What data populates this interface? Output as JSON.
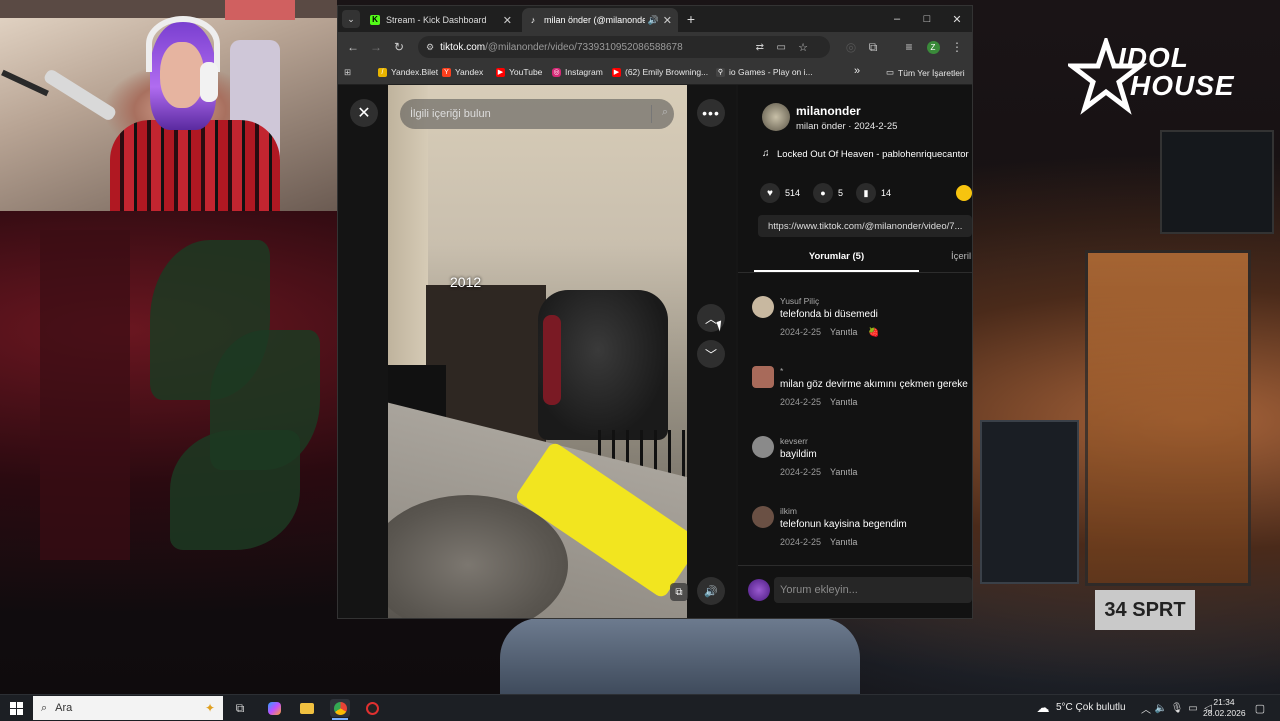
{
  "overlay": {
    "logo_line1": "IDOL",
    "logo_line2": "HOUSE"
  },
  "browser": {
    "tabs": [
      {
        "label": "Stream - Kick Dashboard",
        "active": false
      },
      {
        "label": "milan önder (@milanonder)",
        "active": true
      }
    ],
    "new_tab": "+",
    "window_controls": {
      "minimize": "–",
      "maximize": "□",
      "close": "✕"
    },
    "url_host": "tiktok.com",
    "url_path": "/@milanonder/video/7339310952086588678",
    "profile_initial": "Z",
    "bookmarks": [
      {
        "label": "Yandex.Bilet",
        "icon_color": "#e8b400"
      },
      {
        "label": "Yandex",
        "icon_color": "#fc3f1d"
      },
      {
        "label": "YouTube",
        "icon_color": "#ff0000"
      },
      {
        "label": "Instagram",
        "icon_color": "#d62976"
      },
      {
        "label": "(62) Emily Browning...",
        "icon_color": "#ff0000"
      },
      {
        "label": "io Games - Play on i...",
        "icon_color": "#444444"
      }
    ],
    "bookmarks_more": "»",
    "all_bookmarks": "Tüm Yer İşaretleri"
  },
  "tiktok": {
    "search_placeholder": "İlgili içeriği bulun",
    "video_overlay_text": "2012",
    "author": {
      "username": "milanonder",
      "display": "milan önder · 2024-2-25"
    },
    "music": "Locked Out Of Heaven - pablohenriquecantor",
    "stats": {
      "likes": "514",
      "comments": "5",
      "saves": "14"
    },
    "share_url": "https://www.tiktok.com/@milanonder/video/7...",
    "tabs": {
      "comments": "Yorumlar (5)",
      "content": "İçeril"
    },
    "comments": [
      {
        "user": "Yusuf Piliç",
        "text": "telefonda bi düsemedi",
        "date": "2024-2-25",
        "reply": "Yanıtla",
        "has_emoji": true
      },
      {
        "user": "*",
        "text": "milan göz devirme akımını çekmen gereke",
        "date": "2024-2-25",
        "reply": "Yanıtla",
        "has_emoji": false
      },
      {
        "user": "kevserr",
        "text": "bayildim",
        "date": "2024-2-25",
        "reply": "Yanıtla",
        "has_emoji": false
      },
      {
        "user": "ilkim",
        "text": "telefonun kayisina begendim",
        "date": "2024-2-25",
        "reply": "Yanıtla",
        "has_emoji": false
      }
    ],
    "comment_placeholder": "Yorum ekleyin..."
  },
  "taskbar": {
    "search_placeholder": "Ara",
    "weather": "5°C  Çok bulutlu",
    "time": "21:34",
    "date": "28.02.2026"
  }
}
